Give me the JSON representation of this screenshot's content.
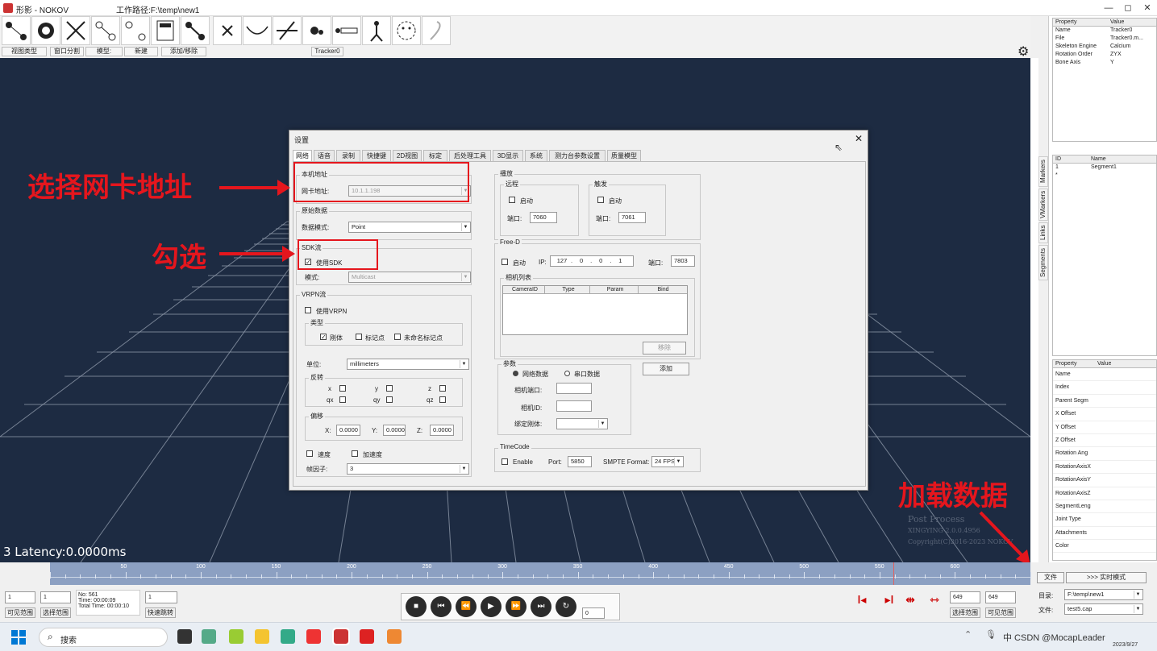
{
  "window": {
    "title": "形影 - NOKOV",
    "path": "工作路径:F:\\temp\\new1",
    "controls": [
      "—",
      "◻",
      "✕"
    ]
  },
  "toolbar": {
    "labels": [
      "视图类型",
      "窗口分割",
      "模型:",
      "新建",
      "添加/移除",
      "Tracker0"
    ]
  },
  "right_panel": {
    "props_header": [
      "Property",
      "Value"
    ],
    "props": [
      [
        "Name",
        "Tracker0"
      ],
      [
        "File",
        "Tracker0.m..."
      ],
      [
        "Skeleton Engine",
        "Calcium"
      ],
      [
        "Rotation Order",
        "ZYX"
      ],
      [
        "Bone Axis",
        "Y"
      ]
    ],
    "list_header": [
      "ID",
      "Name"
    ],
    "list": [
      [
        "1",
        "Segment1"
      ],
      [
        "*",
        ""
      ]
    ],
    "tabs": [
      "Markers",
      "VMarkers",
      "Links",
      "Segments"
    ],
    "seg_header": [
      "Property",
      "Value"
    ],
    "seg_props": [
      "Name",
      "Index",
      "Parent Segm",
      "X Offset",
      "Y Offset",
      "Z Offset",
      "Rotation Ang",
      "RotationAxisX",
      "RotationAxisY",
      "RotationAxisZ",
      "SegmentLeng",
      "Joint Type",
      "Attachments",
      "Color"
    ]
  },
  "dialog": {
    "title": "设置",
    "tabs": [
      "网络",
      "语音",
      "录制",
      "快捷键",
      "2D视图",
      "标定",
      "后处理工具",
      "3D显示",
      "系统",
      "测力台参数设置",
      "质量模型"
    ],
    "local": {
      "group": "本机地址",
      "nic_label": "网卡地址:",
      "nic_value": "10.1.1.198"
    },
    "raw": {
      "group": "原始数据",
      "mode_label": "数据模式:",
      "mode_value": "Point"
    },
    "sdk": {
      "group": "SDK流",
      "use_label": "使用SDK",
      "mode_label": "模式:",
      "mode_value": "Multicast"
    },
    "vrpn": {
      "group": "VRPN流",
      "use_label": "使用VRPN",
      "type_group": "类型",
      "types": [
        "刚体",
        "标记点",
        "未命名标记点"
      ],
      "unit_label": "单位:",
      "unit_value": "millimeters",
      "axis_group": "反转",
      "axes": [
        "x",
        "y",
        "z",
        "qx",
        "qy",
        "qz"
      ],
      "offset_group": "偏移",
      "ox": "X:",
      "oy": "Y:",
      "oz": "Z:",
      "offset_value": "0.0000",
      "speed": "速度",
      "accel": "加速度",
      "frame_label": "帧因子:",
      "frame_value": "3"
    },
    "broadcast": {
      "group": "播放",
      "remote": "远程",
      "trigger": "触发",
      "start": "启动",
      "port_label": "端口:",
      "remote_port": "7060",
      "trigger_port": "7061"
    },
    "freed": {
      "group": "Free-D",
      "start": "启动",
      "ip_label": "IP:",
      "ip": [
        "127",
        "0",
        "0",
        "1"
      ],
      "port_label": "端口:",
      "port": "7803",
      "cam_group": "相机列表",
      "cols": [
        "CameraID",
        "Type",
        "Param",
        "Bind"
      ],
      "remove": "移除"
    },
    "params": {
      "group": "参数",
      "net": "网络数据",
      "serial": "串口数据",
      "cam_port": "相机端口:",
      "cam_id": "相机ID:",
      "bind": "绑定刚体:",
      "add": "添加"
    },
    "timecode": {
      "group": "TimeCode",
      "enable": "Enable",
      "port_label": "Port:",
      "port": "5850",
      "smpte_label": "SMPTE Format:",
      "smpte": "24 FPS"
    }
  },
  "annotations": {
    "a1": "选择网卡地址",
    "a2": "勾选",
    "a3": "加载数据"
  },
  "viewport": {
    "latency": "3 Latency:0.0000ms",
    "watermark": [
      "Post Process",
      "XINGYING 2.0.0.4956",
      "Copyright(C)2016-2023 NOKOV"
    ]
  },
  "timeline": {
    "ticks": [
      "50",
      "100",
      "150",
      "200",
      "250",
      "300",
      "350",
      "400",
      "450",
      "500",
      "550",
      "600"
    ]
  },
  "bottom": {
    "start": "1",
    "start2": "1",
    "frame_no": "No: 561",
    "time": "Time: 00:00:09",
    "total": "Total Time: 00:00:10",
    "jump": "1",
    "l1": "可见范围",
    "l2": "选择范围",
    "l3": "快速跳转",
    "speed": "0",
    "r1": "649",
    "r2": "649",
    "rl1": "选择范围",
    "rl2": "可见范围"
  },
  "loader": {
    "file_btn": "文件",
    "mode_btn": ">>> 实时模式",
    "dir_label": "目录:",
    "dir_value": "F:\\temp\\new1",
    "file_label": "文件:",
    "file_value": "test5.cap"
  },
  "taskbar": {
    "search": "搜索",
    "tray": "中 CSDN @MocapLeader",
    "date": "2023/9/27"
  }
}
